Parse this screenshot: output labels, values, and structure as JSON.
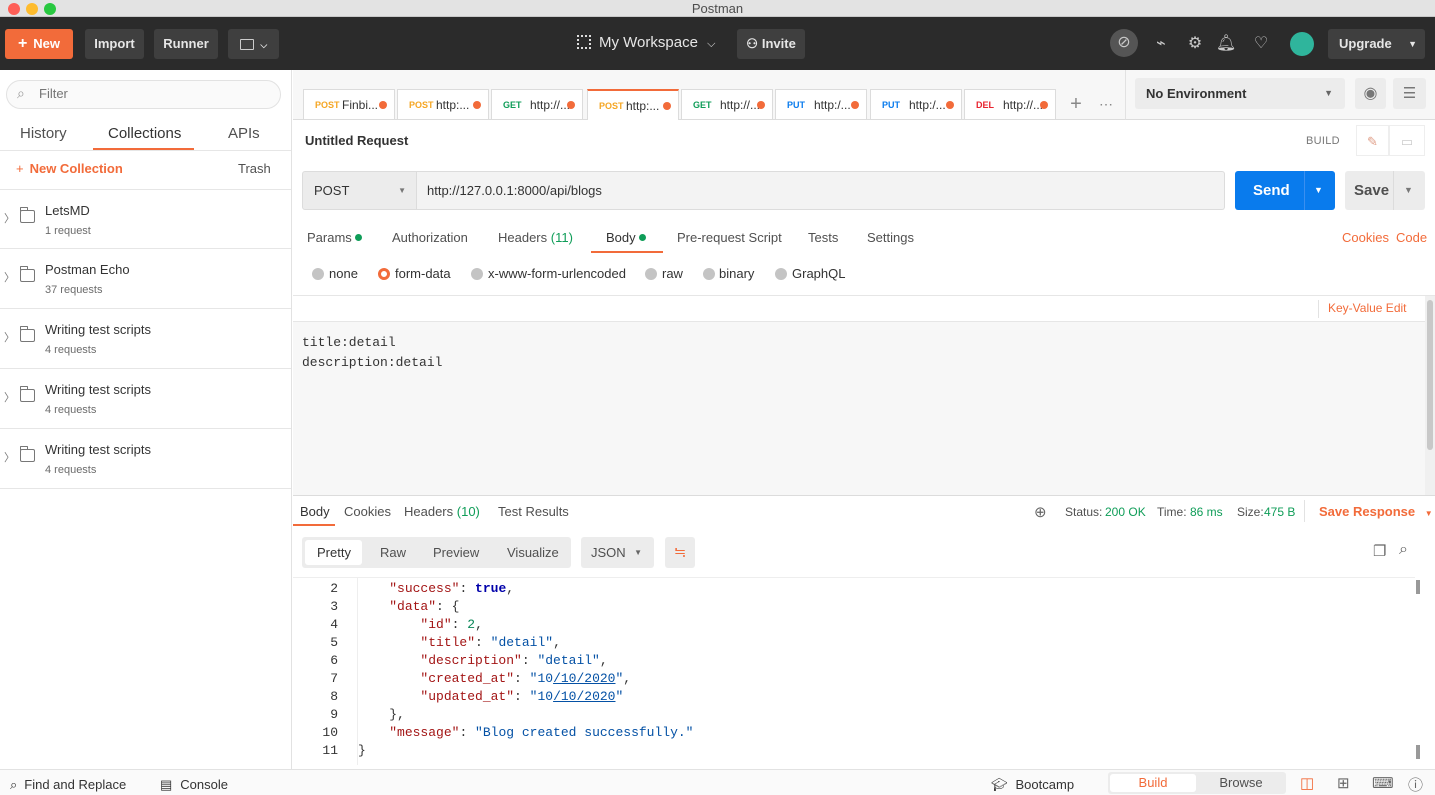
{
  "app": {
    "title": "Postman"
  },
  "header": {
    "new_label": "New",
    "import_label": "Import",
    "runner_label": "Runner",
    "workspace_label": "My Workspace",
    "invite_label": "Invite",
    "upgrade_label": "Upgrade"
  },
  "sidebar": {
    "filter_placeholder": "Filter",
    "tabs": [
      {
        "label": "History"
      },
      {
        "label": "Collections"
      },
      {
        "label": "APIs"
      }
    ],
    "new_collection_label": "New Collection",
    "trash_label": "Trash",
    "collections": [
      {
        "name": "LetsMD",
        "count": "1 request"
      },
      {
        "name": "Postman Echo",
        "count": "37 requests"
      },
      {
        "name": "Writing test scripts",
        "count": "4 requests"
      },
      {
        "name": "Writing test scripts",
        "count": "4 requests"
      },
      {
        "name": "Writing test scripts",
        "count": "4 requests"
      }
    ]
  },
  "request_tabs": [
    {
      "method": "POST",
      "url": "Finbi...",
      "color": "#f5a623"
    },
    {
      "method": "POST",
      "url": "http:...",
      "color": "#f5a623"
    },
    {
      "method": "GET",
      "url": "http://...",
      "color": "#0f9d58"
    },
    {
      "method": "POST",
      "url": "http:...",
      "color": "#f5a623"
    },
    {
      "method": "GET",
      "url": "http://...",
      "color": "#0f9d58"
    },
    {
      "method": "PUT",
      "url": "http:/...",
      "color": "#097bed"
    },
    {
      "method": "PUT",
      "url": "http:/...",
      "color": "#097bed"
    },
    {
      "method": "DEL",
      "url": "http://...",
      "color": "#e8242f"
    }
  ],
  "environment": {
    "selected": "No Environment"
  },
  "request": {
    "title": "Untitled Request",
    "build_label": "BUILD",
    "method": "POST",
    "url": "http://127.0.0.1:8000/api/blogs",
    "send_label": "Send",
    "save_label": "Save",
    "tabs": {
      "params": "Params",
      "authorization": "Authorization",
      "headers": "Headers",
      "headers_count": "(11)",
      "body": "Body",
      "prerequest": "Pre-request Script",
      "tests": "Tests",
      "settings": "Settings"
    },
    "cookies_label": "Cookies",
    "code_label": "Code",
    "body_types": [
      "none",
      "form-data",
      "x-www-form-urlencoded",
      "raw",
      "binary",
      "GraphQL"
    ],
    "key_value_edit_label": "Key-Value Edit",
    "bulk_lines": [
      "title:detail",
      "description:detail"
    ]
  },
  "response": {
    "tabs": {
      "body": "Body",
      "cookies": "Cookies",
      "headers": "Headers",
      "headers_count": "(10)",
      "test_results": "Test Results"
    },
    "status_label": "Status:",
    "status_value": "200 OK",
    "time_label": "Time:",
    "time_value": "86 ms",
    "size_label": "Size:",
    "size_value": "475 B",
    "save_response_label": "Save Response",
    "views": [
      "Pretty",
      "Raw",
      "Preview",
      "Visualize"
    ],
    "format": "JSON",
    "line_numbers": [
      "2",
      "3",
      "4",
      "5",
      "6",
      "7",
      "8",
      "9",
      "10",
      "11"
    ]
  },
  "footer": {
    "find_replace_label": "Find and Replace",
    "console_label": "Console",
    "bootcamp_label": "Bootcamp",
    "build_label": "Build",
    "browse_label": "Browse"
  },
  "colors": {
    "accent": "#f26b3a",
    "send": "#097bed",
    "ok": "#0f9d58",
    "header_bg": "#2b2b2b"
  }
}
